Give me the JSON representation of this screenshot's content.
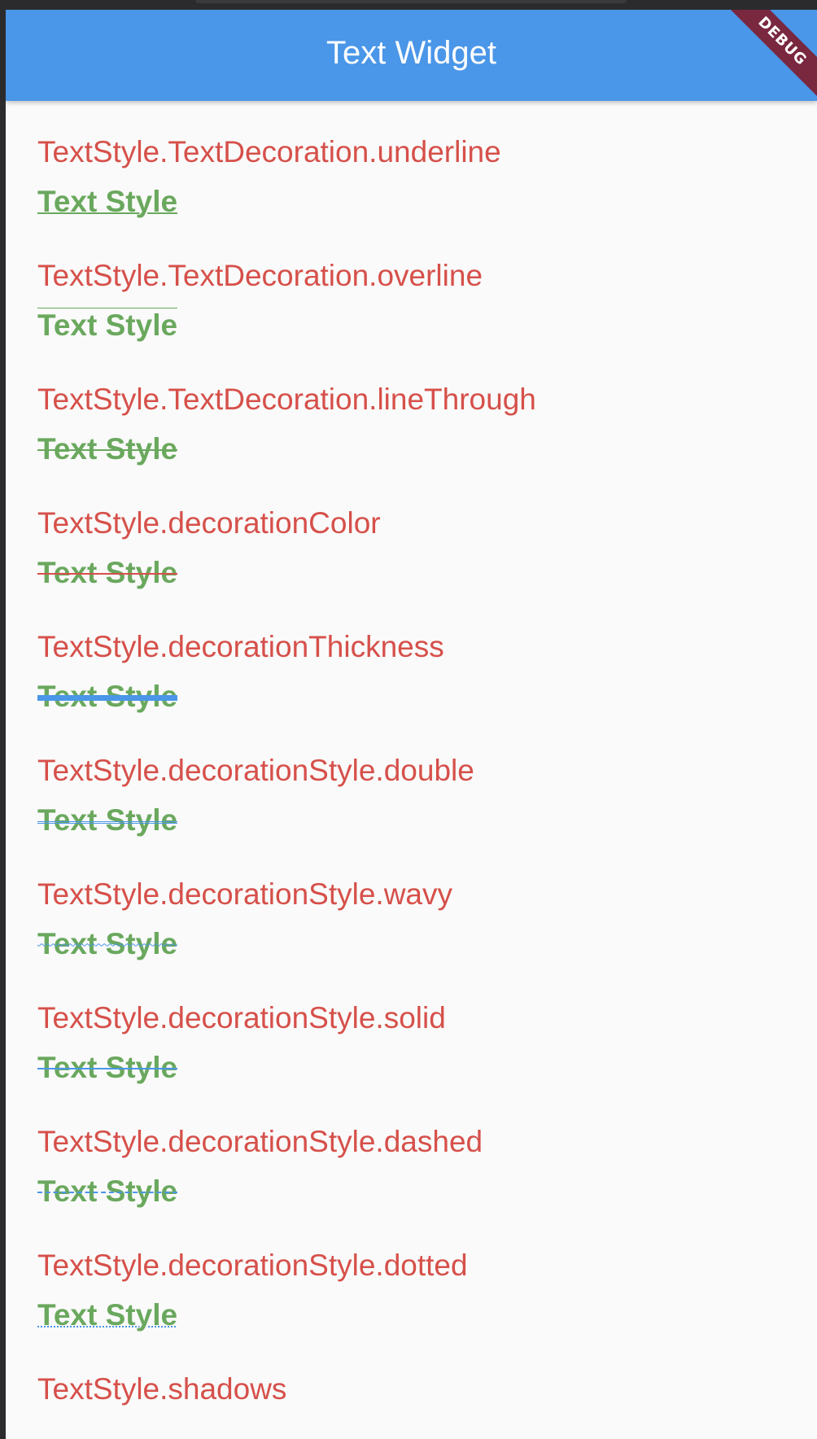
{
  "app": {
    "title": "Text Widget",
    "debug_banner": "DEBUG"
  },
  "colors": {
    "app_bar": "#4a96e8",
    "label": "#d6504a",
    "sample_text": "#6aa85e",
    "debug_banner": "#7a2740",
    "decoration_blue": "#4a96e8"
  },
  "sample_text": "Text Style",
  "items": [
    {
      "label": "TextStyle.TextDecoration.underline",
      "sample": "Text Style"
    },
    {
      "label": "TextStyle.TextDecoration.overline",
      "sample": "Text Style"
    },
    {
      "label": "TextStyle.TextDecoration.lineThrough",
      "sample": "Text Style"
    },
    {
      "label": "TextStyle.decorationColor",
      "sample": "Text Style"
    },
    {
      "label": "TextStyle.decorationThickness",
      "sample": "Text Style"
    },
    {
      "label": "TextStyle.decorationStyle.double",
      "sample": "Text Style"
    },
    {
      "label": "TextStyle.decorationStyle.wavy",
      "sample": "Text Style"
    },
    {
      "label": "TextStyle.decorationStyle.solid",
      "sample": "Text Style"
    },
    {
      "label": "TextStyle.decorationStyle.dashed",
      "sample": "Text Style"
    },
    {
      "label": "TextStyle.decorationStyle.dotted",
      "sample": "Text Style"
    },
    {
      "label": "TextStyle.shadows"
    }
  ]
}
